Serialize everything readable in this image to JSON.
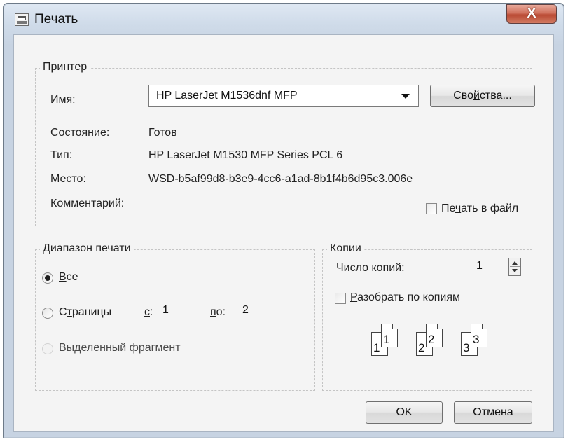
{
  "window": {
    "title": "Печать",
    "close_label": "X"
  },
  "printer": {
    "legend": "Принтер",
    "name_label_accel": "И",
    "name_label_rest": "мя:",
    "selected_printer": "HP LaserJet M1536dnf MFP",
    "properties_pre": "Сво",
    "properties_accel": "й",
    "properties_post": "ства...",
    "status_label": "Состояние:",
    "status_value": "Готов",
    "type_label": "Тип:",
    "type_value": "HP LaserJet M1530 MFP Series PCL 6",
    "location_label": "Место:",
    "location_value": "WSD-b5af99d8-b3e9-4cc6-a1ad-8b1f4b6d95c3.006e",
    "comment_label": "Комментарий:",
    "print_to_file_pre": "Пе",
    "print_to_file_accel": "ч",
    "print_to_file_post": "ать в файл",
    "print_to_file_checked": false
  },
  "range": {
    "legend": "Диапазон печати",
    "all_accel": "В",
    "all_rest": "се",
    "pages_pre": "С",
    "pages_accel": "т",
    "pages_post": "раницы",
    "from_accel": "с",
    "from_rest": ":",
    "from_value": "1",
    "to_accel": "п",
    "to_rest": "о:",
    "to_value": "2",
    "selection_pre": "Вы",
    "selection_accel": "д",
    "selection_post": "еленный фрагмент",
    "selected_option": "all"
  },
  "copies": {
    "legend": "Копии",
    "count_pre": "Число ",
    "count_accel": "к",
    "count_post": "опий:",
    "count_value": "1",
    "collate_accel": "Р",
    "collate_rest": "азобрать по копиям",
    "collate_checked": false,
    "collate_page_labels": [
      "1",
      "1",
      "2",
      "2",
      "3",
      "3"
    ]
  },
  "buttons": {
    "ok": "OK",
    "cancel": "Отмена"
  },
  "colors": {
    "titlebar": "#cfdbe9",
    "close_button": "#c75a44",
    "dialog_background": "#f4f4f4"
  }
}
